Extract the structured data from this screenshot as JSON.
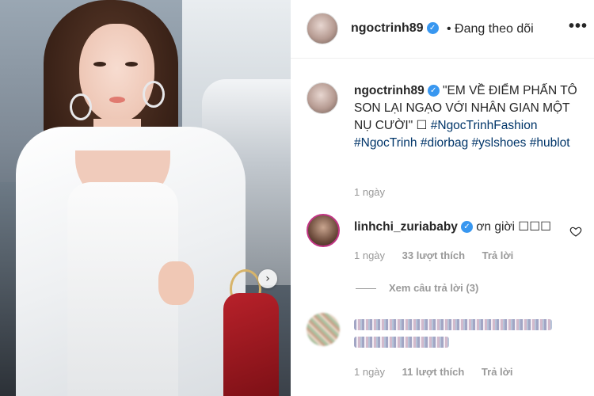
{
  "post": {
    "author": "ngoctrinh89",
    "follow_status": "• Đang theo dõi",
    "more_icon": "ellipsis-icon",
    "caption_author": "ngoctrinh89",
    "caption_text": "\"EM VỀ ĐIỂM PHẤN TÔ SON LẠI  NGẠO VỚI NHÂN GIAN MỘT NỤ CƯỜI\" ☐",
    "hashtags": [
      "#NgocTrinhFashion",
      "#NgocTrinh",
      "#diorbag",
      "#yslshoes",
      "#hublot"
    ],
    "caption_time": "1 ngày",
    "carousel_next_icon": "chevron-right-icon"
  },
  "comments": [
    {
      "username": "linhchi_zuriababy",
      "text": "ơn giời ☐☐☐",
      "time": "1 ngày",
      "likes": "33 lượt thích",
      "reply": "Trả lời",
      "view_replies": "Xem câu trả lời (3)"
    },
    {
      "time": "1 ngày",
      "likes": "11 lượt thích",
      "reply": "Trả lời"
    }
  ],
  "colors": {
    "verified": "#3897f0",
    "hashtag": "#003569",
    "muted": "#999999",
    "text": "#262626"
  }
}
